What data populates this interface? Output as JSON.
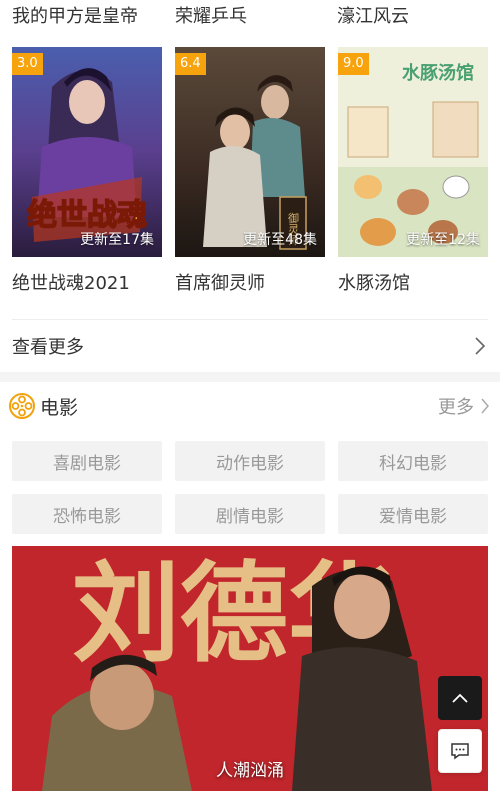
{
  "previous_titles": [
    "我的甲方是皇帝",
    "荣耀乒乓",
    "濠江风云"
  ],
  "anime_items": [
    {
      "score": "3.0",
      "update": "更新至17集",
      "title": "绝世战魂2021",
      "poster_text": "绝世战魂"
    },
    {
      "score": "6.4",
      "update": "更新至48集",
      "title": "首席御灵师",
      "poster_text": "御灵师"
    },
    {
      "score": "9.0",
      "update": "更新至12集",
      "title": "水豚汤馆",
      "poster_text": "水豚汤馆"
    }
  ],
  "see_more": "查看更多",
  "movie_section": {
    "title": "电影",
    "more": "更多",
    "categories": [
      "喜剧电影",
      "动作电影",
      "科幻电影",
      "恐怖电影",
      "剧情电影",
      "爱情电影"
    ],
    "banner_caption": "人潮汹涌",
    "banner_text": "刘德华"
  },
  "colors": {
    "score_badge": "#f7a30d",
    "movie_icon": "#f2a20c",
    "banner_red": "#c0262b"
  },
  "icons": [
    "chevron-right-icon",
    "film-reel-icon",
    "chevron-up-icon",
    "chat-icon"
  ]
}
